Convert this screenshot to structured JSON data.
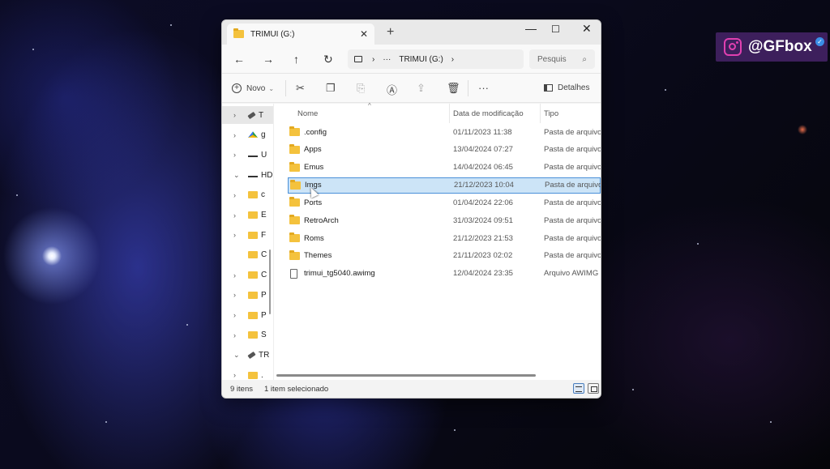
{
  "window": {
    "tab_title": "TRIMUI (G:)",
    "tab_close": "✕",
    "new_tab": "+",
    "controls": {
      "minimize": "—",
      "maximize": "☐",
      "close": "✕"
    }
  },
  "nav": {
    "back": "←",
    "forward": "→",
    "up": "↑",
    "refresh": "↻",
    "address": {
      "chevron1": "›",
      "ellipsis": "···",
      "location": "TRIMUI (G:)",
      "chevron2": "›"
    },
    "search_placeholder": "Pesquis",
    "search_icon": "⌕"
  },
  "toolbar": {
    "new_label": "Novo",
    "new_caret": "⌄",
    "cut": "✂",
    "copy": "❐",
    "paste": "⎘",
    "rename": "Ⓐ",
    "share": "⇪",
    "delete": "🗑",
    "more": "···",
    "details_label": "Detalhes"
  },
  "sidebar": {
    "items": [
      {
        "chev": "›",
        "icon": "usb-icon",
        "label": "T",
        "selected": true
      },
      {
        "chev": "›",
        "icon": "gdrive-icon",
        "label": "g"
      },
      {
        "chev": "›",
        "icon": "drive-icon",
        "label": "U"
      },
      {
        "chev": "⌄",
        "icon": "drive-icon",
        "label": "HD"
      },
      {
        "chev": "›",
        "icon": "folder-icon",
        "label": "c"
      },
      {
        "chev": "›",
        "icon": "folder-icon",
        "label": "E"
      },
      {
        "chev": "›",
        "icon": "folder-icon",
        "label": "F"
      },
      {
        "chev": "",
        "icon": "folder-icon",
        "label": "C"
      },
      {
        "chev": "›",
        "icon": "folder-icon",
        "label": "C"
      },
      {
        "chev": "›",
        "icon": "folder-icon",
        "label": "P"
      },
      {
        "chev": "›",
        "icon": "folder-icon",
        "label": "P"
      },
      {
        "chev": "›",
        "icon": "folder-icon",
        "label": "S"
      },
      {
        "chev": "⌄",
        "icon": "usb-icon",
        "label": "TR"
      },
      {
        "chev": "›",
        "icon": "folder-icon",
        "label": "."
      }
    ]
  },
  "columns": {
    "name": "Nome",
    "date": "Data de modificação",
    "type": "Tipo",
    "sort_caret": "^"
  },
  "files": [
    {
      "name": ".config",
      "date": "01/11/2023 11:38",
      "type": "Pasta de arquivos",
      "kind": "folder"
    },
    {
      "name": "Apps",
      "date": "13/04/2024 07:27",
      "type": "Pasta de arquivos",
      "kind": "folder"
    },
    {
      "name": "Emus",
      "date": "14/04/2024 06:45",
      "type": "Pasta de arquivos",
      "kind": "folder"
    },
    {
      "name": "Imgs",
      "date": "21/12/2023 10:04",
      "type": "Pasta de arquivos",
      "kind": "folder",
      "selected": true
    },
    {
      "name": "Ports",
      "date": "01/04/2024 22:06",
      "type": "Pasta de arquivos",
      "kind": "folder"
    },
    {
      "name": "RetroArch",
      "date": "31/03/2024 09:51",
      "type": "Pasta de arquivos",
      "kind": "folder"
    },
    {
      "name": "Roms",
      "date": "21/12/2023 21:53",
      "type": "Pasta de arquivos",
      "kind": "folder"
    },
    {
      "name": "Themes",
      "date": "21/11/2023 02:02",
      "type": "Pasta de arquivos",
      "kind": "folder"
    },
    {
      "name": "trimui_tg5040.awimg",
      "date": "12/04/2024 23:35",
      "type": "Arquivo AWIMG",
      "kind": "file"
    }
  ],
  "status": {
    "count": "9 itens",
    "selection": "1 item selecionado"
  },
  "badge": {
    "handle": "@GFbox",
    "verified": "✓",
    "accent": "#e040b0",
    "background": "#3d1f5c"
  }
}
